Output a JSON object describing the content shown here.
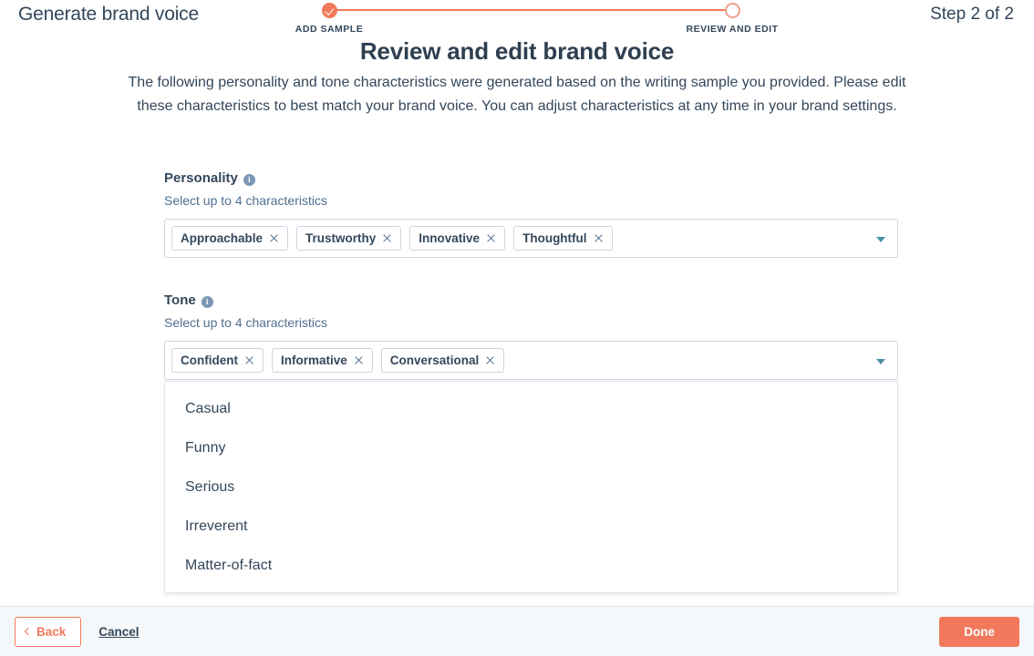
{
  "header": {
    "wizard_title": "Generate brand voice",
    "step_counter": "Step 2 of 2"
  },
  "stepper": {
    "steps": [
      {
        "label": "ADD SAMPLE",
        "state": "done"
      },
      {
        "label": "REVIEW AND EDIT",
        "state": "pending"
      }
    ],
    "accent_color": "#f2795b"
  },
  "page": {
    "title": "Review and edit brand voice",
    "description": "The following personality and tone characteristics were generated based on the writing sample you provided.  Please edit these characteristics to best match your brand voice. You can adjust characteristics at any time in your brand settings."
  },
  "personality": {
    "label": "Personality",
    "info_icon": "info-icon",
    "help": "Select up to 4 characteristics",
    "tags": [
      "Approachable",
      "Trustworthy",
      "Innovative",
      "Thoughtful"
    ],
    "caret_icon": "chevron-down-icon"
  },
  "tone": {
    "label": "Tone",
    "info_icon": "info-icon",
    "help": "Select up to 4 characteristics",
    "tags": [
      "Confident",
      "Informative",
      "Conversational"
    ],
    "caret_icon": "chevron-down-icon",
    "dropdown_options": [
      "Casual",
      "Funny",
      "Serious",
      "Irreverent",
      "Matter-of-fact"
    ]
  },
  "footer": {
    "back_label": "Back",
    "back_icon": "chevron-left-icon",
    "cancel_label": "Cancel",
    "done_label": "Done",
    "done_color": "#f2795b"
  }
}
